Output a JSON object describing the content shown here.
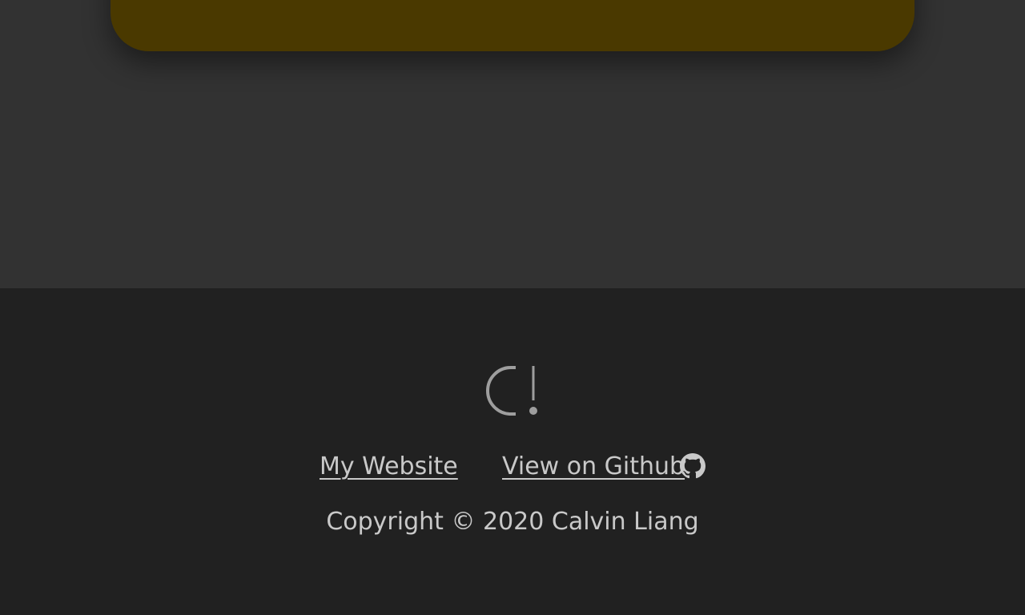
{
  "header_card": {
    "background": "#4a3900",
    "icons": [
      "window-icon",
      "trash-icon"
    ]
  },
  "footer": {
    "logo": "C!",
    "links": [
      {
        "label": "My Website"
      },
      {
        "label": "View on Github ",
        "icon": "github-icon"
      }
    ],
    "copyright": "Copyright © 2020 Calvin Liang"
  },
  "colors": {
    "page_bg": "#323232",
    "footer_bg": "#212121",
    "text": "#c9c9c9",
    "logo": "#9e9e9e"
  }
}
